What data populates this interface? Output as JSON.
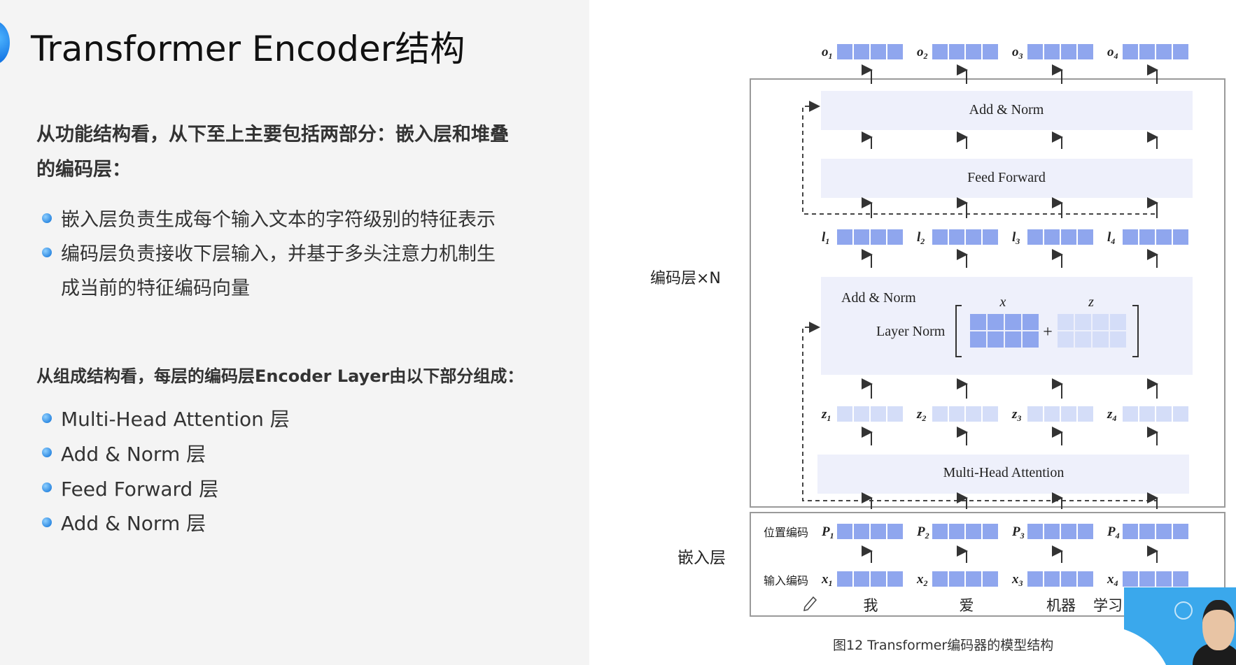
{
  "slide": {
    "title": "Transformer Encoder结构",
    "section1": {
      "heading_line1": "从功能结构看，从下至上主要包括两部分：嵌入层和堆叠",
      "heading_line2": "的编码层：",
      "bullets": [
        "嵌入层负责生成每个输入文本的字符级别的特征表示",
        "编码层负责接收下层输入，并基于多头注意力机制生",
        "成当前的特征编码向量"
      ]
    },
    "section2": {
      "heading": "从组成结构看，每层的编码层Encoder Layer由以下部分组成：",
      "bullets": [
        "Multi-Head Attention 层",
        "Add & Norm 层",
        "Feed Forward 层",
        "Add & Norm 层"
      ]
    }
  },
  "diagram": {
    "outputs": [
      "o1",
      "o2",
      "o3",
      "o4"
    ],
    "l_labels": [
      "l1",
      "l2",
      "l3",
      "l4"
    ],
    "z_labels": [
      "z1",
      "z2",
      "z3",
      "z4"
    ],
    "p_labels": [
      "P1",
      "P2",
      "P3",
      "P4"
    ],
    "x_labels": [
      "x1",
      "x2",
      "x3",
      "x4"
    ],
    "blocks": {
      "add_norm_top": "Add & Norm",
      "feed_forward": "Feed Forward",
      "add_norm_mid": "Add & Norm",
      "layer_norm": "Layer Norm",
      "x_symbol": "x",
      "z_symbol": "z",
      "plus": "+",
      "multi_head": "Multi-Head Attention"
    },
    "side_labels": {
      "encoder": "编码层×N",
      "embedding": "嵌入层",
      "position_encoding": "位置编码",
      "input_encoding": "输入编码"
    },
    "tokens": [
      "我",
      "爱",
      "机器",
      "学习"
    ],
    "caption": "图12 Transformer编码器的模型结构",
    "colors": {
      "dark_cell": "#8fa6ee",
      "light_cell": "#d4ddf8",
      "block_bg": "#eef0fb",
      "frame": "#9a9a9a"
    }
  }
}
